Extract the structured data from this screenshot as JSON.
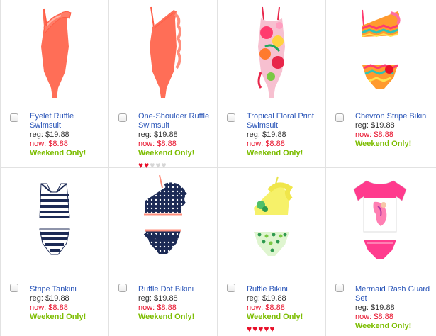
{
  "colors": {
    "link": "#2a55b8",
    "sale": "#e8102a",
    "promo": "#7cbd00",
    "heart_on": "#e8102a",
    "heart_off": "#d6d6d6"
  },
  "products": [
    {
      "name": "Eyelet Ruffle Swimsuit",
      "reg_label": "reg:",
      "reg_price": "$19.88",
      "now_label": "now:",
      "now_price": "$8.88",
      "promo": "Weekend Only!",
      "rating": null,
      "image": "coral one-shoulder ruffle swimsuit"
    },
    {
      "name": "One-Shoulder Ruffle Swimsuit",
      "reg_label": "reg:",
      "reg_price": "$19.88",
      "now_label": "now:",
      "now_price": "$8.88",
      "promo": "Weekend Only!",
      "rating": 2,
      "rating_max": 5,
      "image": "coral one-shoulder swimsuit with side ruffle"
    },
    {
      "name": "Tropical Floral Print Swimsuit",
      "reg_label": "reg:",
      "reg_price": "$19.88",
      "now_label": "now:",
      "now_price": "$8.88",
      "promo": "Weekend Only!",
      "rating": null,
      "image": "pink tropical floral print swimsuit"
    },
    {
      "name": "Chevron Stripe Bikini",
      "reg_label": "reg:",
      "reg_price": "$19.88",
      "now_label": "now:",
      "now_price": "$8.88",
      "promo": "Weekend Only!",
      "rating": null,
      "image": "multicolor chevron stripe bikini"
    },
    {
      "name": "Stripe Tankini",
      "reg_label": "reg:",
      "reg_price": "$19.88",
      "now_label": "now:",
      "now_price": "$8.88",
      "promo": "Weekend Only!",
      "rating": null,
      "image": "navy and white stripe tankini"
    },
    {
      "name": "Ruffle Dot Bikini",
      "reg_label": "reg:",
      "reg_price": "$19.88",
      "now_label": "now:",
      "now_price": "$8.88",
      "promo": "Weekend Only!",
      "rating": null,
      "image": "navy polka dot ruffle bikini"
    },
    {
      "name": "Ruffle Bikini",
      "reg_label": "reg:",
      "reg_price": "$19.88",
      "now_label": "now:",
      "now_price": "$8.88",
      "promo": "Weekend Only!",
      "rating": 5,
      "rating_max": 5,
      "image": "yellow ruffle top with green floral bottom bikini"
    },
    {
      "name": "Mermaid Rash Guard Set",
      "reg_label": "reg:",
      "reg_price": "$19.88",
      "now_label": "now:",
      "now_price": "$8.88",
      "promo": "Weekend Only!",
      "rating": null,
      "image": "pink and white mermaid rash guard set"
    }
  ]
}
